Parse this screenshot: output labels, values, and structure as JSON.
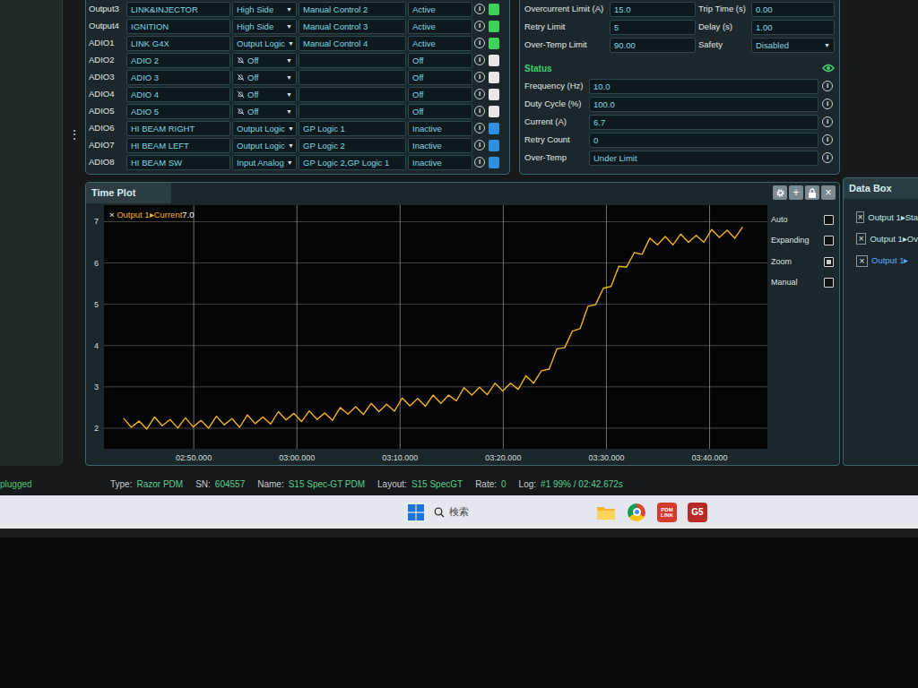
{
  "sidebar": {
    "menu_glyph": "⋮"
  },
  "outputs": {
    "info_glyph": "i",
    "dropdown_glyph": "▼",
    "rows": [
      {
        "channel": "Output3",
        "name": "LINK&INJECTOR",
        "mode": "High Side",
        "mode_off": false,
        "function": "Manual Control 2",
        "state": "Active",
        "status_color": "#3fd15a"
      },
      {
        "channel": "Output4",
        "name": "IGNITION",
        "mode": "High Side",
        "mode_off": false,
        "function": "Manual Control 3",
        "state": "Active",
        "status_color": "#3fd15a"
      },
      {
        "channel": "ADIO1",
        "name": "LINK G4X",
        "mode": "Output Logic",
        "mode_off": false,
        "function": "Manual Control 4",
        "state": "Active",
        "status_color": "#3fd15a"
      },
      {
        "channel": "ADIO2",
        "name": "ADIO 2",
        "mode": "Off",
        "mode_off": true,
        "function": "",
        "state": "Off",
        "status_color": "#e8e8e8"
      },
      {
        "channel": "ADIO3",
        "name": "ADIO 3",
        "mode": "Off",
        "mode_off": true,
        "function": "",
        "state": "Off",
        "status_color": "#e8e8e8"
      },
      {
        "channel": "ADIO4",
        "name": "ADIO 4",
        "mode": "Off",
        "mode_off": true,
        "function": "",
        "state": "Off",
        "status_color": "#e8e8e8"
      },
      {
        "channel": "ADIO5",
        "name": "ADIO 5",
        "mode": "Off",
        "mode_off": true,
        "function": "",
        "state": "Off",
        "status_color": "#e8e8e8"
      },
      {
        "channel": "ADIO6",
        "name": "HI BEAM RIGHT",
        "mode": "Output Logic",
        "mode_off": false,
        "function": "GP Logic 1",
        "state": "Inactive",
        "status_color": "#2f8fe0"
      },
      {
        "channel": "ADIO7",
        "name": "HI BEAM LEFT",
        "mode": "Output Logic",
        "mode_off": false,
        "function": "GP Logic 2",
        "state": "Inactive",
        "status_color": "#2f8fe0"
      },
      {
        "channel": "ADIO8",
        "name": "HI BEAM SW",
        "mode": "Input Analog",
        "mode_off": false,
        "function": "GP Logic 2,GP Logic 1",
        "state": "Inactive",
        "status_color": "#2f8fe0"
      }
    ]
  },
  "config": {
    "dropdown_glyph": "▼",
    "rows": [
      [
        {
          "label": "Overcurrent Limit (A)",
          "value": "15.0",
          "kind": "field"
        },
        {
          "label": "Trip Time (s)",
          "value": "0.00",
          "kind": "field"
        }
      ],
      [
        {
          "label": "Retry Limit",
          "value": "5",
          "kind": "field"
        },
        {
          "label": "Delay (s)",
          "value": "1.00",
          "kind": "field"
        }
      ],
      [
        {
          "label": "Over-Temp Limit",
          "value": "90.00",
          "kind": "field"
        },
        {
          "label": "Safety",
          "value": "Disabled",
          "kind": "select"
        }
      ]
    ]
  },
  "status": {
    "title": "Status",
    "info_glyph": "i",
    "rows": [
      {
        "label": "Frequency (Hz)",
        "value": "10.0"
      },
      {
        "label": "Duty Cycle (%)",
        "value": "100.0"
      },
      {
        "label": "Current (A)",
        "value": "6.7"
      },
      {
        "label": "Retry Count",
        "value": "0"
      },
      {
        "label": "Over-Temp",
        "value": "Under Limit"
      }
    ]
  },
  "time_plot": {
    "title": "Time Plot",
    "add_glyph": "+",
    "close_glyph": "×",
    "legend": {
      "close_glyph": "×",
      "series": "Output 1▸Current",
      "value": "7.0"
    },
    "y_range": [
      1.5,
      7.4
    ],
    "y_ticks": [
      {
        "label": "2",
        "v": 2
      },
      {
        "label": "3",
        "v": 3
      },
      {
        "label": "4",
        "v": 4
      },
      {
        "label": "5",
        "v": 5
      },
      {
        "label": "6",
        "v": 6
      },
      {
        "label": "7",
        "v": 7
      }
    ],
    "x_range": [
      161.3,
      225.6
    ],
    "x_ticks": [
      {
        "label": "02:50.000",
        "t": 170
      },
      {
        "label": "03:00.000",
        "t": 180
      },
      {
        "label": "03:10.000",
        "t": 190
      },
      {
        "label": "03:20.000",
        "t": 200
      },
      {
        "label": "03:30.000",
        "t": 210
      },
      {
        "label": "03:40.000",
        "t": 220
      }
    ],
    "series": {
      "t_start": 163.2,
      "t_step": 0.75,
      "values": [
        2.24,
        2.02,
        2.17,
        1.98,
        2.27,
        2.06,
        2.21,
        2.0,
        2.25,
        2.03,
        2.19,
        2.0,
        2.29,
        2.08,
        2.23,
        2.02,
        2.32,
        2.11,
        2.27,
        2.1,
        2.4,
        2.2,
        2.36,
        2.16,
        2.42,
        2.21,
        2.37,
        2.19,
        2.5,
        2.34,
        2.52,
        2.33,
        2.6,
        2.4,
        2.58,
        2.41,
        2.73,
        2.54,
        2.72,
        2.53,
        2.8,
        2.6,
        2.8,
        2.66,
        2.98,
        2.8,
        2.99,
        2.81,
        3.09,
        2.9,
        3.09,
        2.94,
        3.27,
        3.09,
        3.39,
        3.43,
        3.92,
        3.95,
        4.35,
        4.41,
        4.95,
        4.99,
        5.39,
        5.43,
        5.92,
        5.9,
        6.25,
        6.21,
        6.6,
        6.44,
        6.64,
        6.44,
        6.7,
        6.5,
        6.67,
        6.5,
        6.81,
        6.62,
        6.79,
        6.6,
        6.87
      ]
    },
    "options": [
      {
        "label": "Auto",
        "checked": false
      },
      {
        "label": "Expanding",
        "checked": false
      },
      {
        "label": "Zoom",
        "checked": true
      },
      {
        "label": "Manual",
        "checked": false
      }
    ]
  },
  "data_box": {
    "title": "Data Box",
    "close_glyph": "×",
    "items": [
      {
        "label": "Output 1▸Sta",
        "selected": false
      },
      {
        "label": "Output 1▸Ov",
        "selected": false
      },
      {
        "label": "Output 1▸",
        "selected": true
      }
    ]
  },
  "status_bar": {
    "connection": "plugged",
    "items": [
      {
        "label": "Type:",
        "value": "Razor PDM"
      },
      {
        "label": "SN:",
        "value": "604557"
      },
      {
        "label": "Name:",
        "value": "S15 Spec-GT PDM"
      },
      {
        "label": "Layout:",
        "value": "S15 SpecGT"
      },
      {
        "label": "Rate:",
        "value": "0"
      },
      {
        "label": "Log:",
        "value": "#1 99% / 02:42.672s"
      }
    ]
  },
  "taskbar": {
    "search_placeholder": "検索",
    "apps": [
      {
        "kind": "folder"
      },
      {
        "kind": "chrome"
      },
      {
        "kind": "badge",
        "text": "PDM LINK",
        "color": "#d23a2e"
      },
      {
        "kind": "badge",
        "text": "G5",
        "color": "#b82a24"
      }
    ]
  }
}
